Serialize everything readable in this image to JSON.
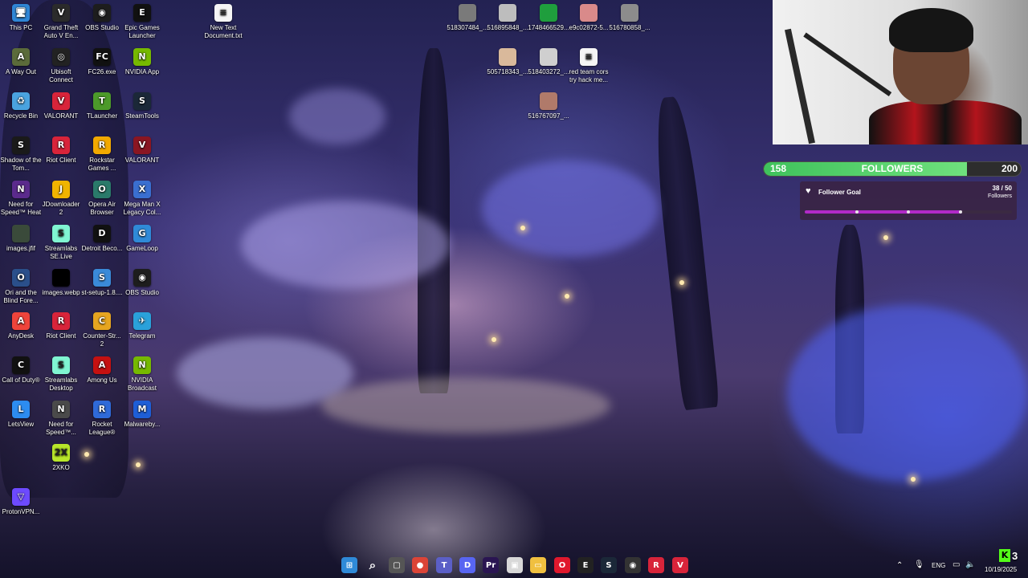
{
  "desktop_icons": [
    {
      "label": "This PC",
      "icon": "this-pc-icon",
      "color": "#2f86d6",
      "glyph": "🖥"
    },
    {
      "label": "Grand Theft Auto V En...",
      "icon": "gta-v-icon",
      "color": "#2b2b2b",
      "glyph": "V"
    },
    {
      "label": "OBS Studio",
      "icon": "obs-studio-icon",
      "color": "#1d1d1d",
      "glyph": "◉"
    },
    {
      "label": "Epic Games Launcher",
      "icon": "epic-games-icon",
      "color": "#111111",
      "glyph": "E"
    },
    {
      "label": "New Text Document.txt",
      "icon": "text-file-icon",
      "color": "#f5f5f5",
      "glyph": "≡"
    },
    {
      "label": "518307484_...",
      "icon": "image-file-icon",
      "color": "#7a7a7a",
      "glyph": ""
    },
    {
      "label": "516895848_...",
      "icon": "image-file-icon",
      "color": "#bdbdbd",
      "glyph": ""
    },
    {
      "label": "174846652​9...",
      "icon": "image-file-icon",
      "color": "#1f9e3d",
      "glyph": ""
    },
    {
      "label": "e9c02872-5...",
      "icon": "image-file-icon",
      "color": "#d98a8a",
      "glyph": ""
    },
    {
      "label": "516780858_...",
      "icon": "image-file-icon",
      "color": "#8c8c8c",
      "glyph": ""
    },
    {
      "label": "A Way Out",
      "icon": "a-way-out-icon",
      "color": "#5b6b3a",
      "glyph": "A"
    },
    {
      "label": "Ubisoft Connect",
      "icon": "ubisoft-icon",
      "color": "#222222",
      "glyph": "◎"
    },
    {
      "label": "FC26.exe",
      "icon": "fc26-icon",
      "color": "#111111",
      "glyph": "FC"
    },
    {
      "label": "NVIDIA App",
      "icon": "nvidia-app-icon",
      "color": "#76b900",
      "glyph": "N"
    },
    {
      "label": "505718343_...",
      "icon": "image-file-icon",
      "color": "#d9b99b",
      "glyph": ""
    },
    {
      "label": "518403272_...",
      "icon": "image-file-icon",
      "color": "#cfcfcf",
      "glyph": ""
    },
    {
      "label": "red team cors try hack me...",
      "icon": "text-file-icon",
      "color": "#f5f5f5",
      "glyph": "≡"
    },
    {
      "label": "Recycle Bin",
      "icon": "recycle-bin-icon",
      "color": "#4aa3df",
      "glyph": "♻"
    },
    {
      "label": "VALORANT",
      "icon": "valorant-icon",
      "color": "#d8243a",
      "glyph": "V"
    },
    {
      "label": "TLauncher",
      "icon": "tlauncher-icon",
      "color": "#4c9a2a",
      "glyph": "T"
    },
    {
      "label": "SteamTools",
      "icon": "steamtools-icon",
      "color": "#1b2838",
      "glyph": "S"
    },
    {
      "label": "516767097_...",
      "icon": "image-file-icon",
      "color": "#b07a6a",
      "glyph": ""
    },
    {
      "label": "Shadow of the Tom...",
      "icon": "shadow-tomb-raider-icon",
      "color": "#1a1a1a",
      "glyph": "S"
    },
    {
      "label": "Riot Client",
      "icon": "riot-client-icon",
      "color": "#d8243a",
      "glyph": "R"
    },
    {
      "label": "Rockstar Games ...",
      "icon": "rockstar-icon",
      "color": "#f2a900",
      "glyph": "R"
    },
    {
      "label": "VALORANT",
      "icon": "valorant-icon",
      "color": "#8a1622",
      "glyph": "V"
    },
    {
      "label": "Need for Speed™ Heat",
      "icon": "nfs-heat-icon",
      "color": "#5b2a8c",
      "glyph": "N"
    },
    {
      "label": "JDownloader 2",
      "icon": "jdownloader-icon",
      "color": "#f0b400",
      "glyph": "J"
    },
    {
      "label": "Opera Air Browser",
      "icon": "opera-air-icon",
      "color": "#2a7a6a",
      "glyph": "O"
    },
    {
      "label": "Mega Man X Legacy Col...",
      "icon": "mega-man-icon",
      "color": "#3a6fd0",
      "glyph": "X"
    },
    {
      "label": "images.jfif",
      "icon": "image-file-icon",
      "color": "#3a4a3a",
      "glyph": ""
    },
    {
      "label": "Streamlabs SE.Live",
      "icon": "streamlabs-se-icon",
      "color": "#80f5d2",
      "glyph": "S"
    },
    {
      "label": "Detroit Beco...",
      "icon": "detroit-icon",
      "color": "#111111",
      "glyph": "D"
    },
    {
      "label": "GameLoop",
      "icon": "gameloop-icon",
      "color": "#2f8ad8",
      "glyph": "G"
    },
    {
      "label": "Ori and the Blind Fore...",
      "icon": "ori-icon",
      "color": "#2a4f8a",
      "glyph": "O"
    },
    {
      "label": "images.webp",
      "icon": "image-file-icon",
      "color": "#000000",
      "glyph": ""
    },
    {
      "label": "st-setup-1.8....",
      "icon": "setup-icon",
      "color": "#3a8ad8",
      "glyph": "S"
    },
    {
      "label": "OBS Studio",
      "icon": "obs-studio-icon",
      "color": "#1d1d1d",
      "glyph": "◉"
    },
    {
      "label": "AnyDesk",
      "icon": "anydesk-icon",
      "color": "#ef443b",
      "glyph": "A"
    },
    {
      "label": "Riot Client",
      "icon": "riot-client-icon",
      "color": "#d8243a",
      "glyph": "R"
    },
    {
      "label": "Counter-Str... 2",
      "icon": "counter-strike-icon",
      "color": "#e6a520",
      "glyph": "C"
    },
    {
      "label": "Telegram",
      "icon": "telegram-icon",
      "color": "#2aa1da",
      "glyph": "✈"
    },
    {
      "label": "Call of Duty®",
      "icon": "call-of-duty-icon",
      "color": "#111111",
      "glyph": "C"
    },
    {
      "label": "Streamlabs Desktop",
      "icon": "streamlabs-icon",
      "color": "#80f5d2",
      "glyph": "S"
    },
    {
      "label": "Among Us",
      "icon": "among-us-icon",
      "color": "#c51111",
      "glyph": "A"
    },
    {
      "label": "NVIDIA Broadcast",
      "icon": "nvidia-broadcast-icon",
      "color": "#76b900",
      "glyph": "N"
    },
    {
      "label": "LetsView",
      "icon": "letsview-icon",
      "color": "#2d8cf0",
      "glyph": "L"
    },
    {
      "label": "Need for Speed™...",
      "icon": "need-for-speed-icon",
      "color": "#4a4a4a",
      "glyph": "N"
    },
    {
      "label": "Rocket League®",
      "icon": "rocket-league-icon",
      "color": "#2f6ad8",
      "glyph": "R"
    },
    {
      "label": "Malwareby...",
      "icon": "malwarebytes-icon",
      "color": "#1e5ed6",
      "glyph": "M"
    },
    {
      "label": "2XKO",
      "icon": "2xko-icon",
      "color": "#b8e62a",
      "glyph": "2X"
    },
    {
      "label": "ProtonVPN...",
      "icon": "protonvpn-icon",
      "color": "#6d4aff",
      "glyph": "▽"
    }
  ],
  "stream_overlay": {
    "followers": {
      "current": "158",
      "target": "200",
      "label": "FOLLOWERS",
      "progress": 0.79
    },
    "goal": {
      "title": "Follower Goal",
      "count": "38 / 50",
      "unit": "Followers",
      "progress": 0.76
    }
  },
  "taskbar": {
    "items": [
      {
        "name": "start-button",
        "icon": "windows-icon",
        "color": "#2f8ad8",
        "glyph": "⊞"
      },
      {
        "name": "taskbar-search",
        "icon": "search-icon",
        "color": "transparent",
        "glyph": "⌕"
      },
      {
        "name": "taskbar-task-view",
        "icon": "task-view-icon",
        "color": "#555",
        "glyph": "▢"
      },
      {
        "name": "taskbar-chrome",
        "icon": "chrome-icon",
        "color": "#db4437",
        "glyph": "●"
      },
      {
        "name": "taskbar-teams",
        "icon": "teams-icon",
        "color": "#5b5fc7",
        "glyph": "T"
      },
      {
        "name": "taskbar-discord",
        "icon": "discord-icon",
        "color": "#5865f2",
        "glyph": "D"
      },
      {
        "name": "taskbar-premiere",
        "icon": "premiere-icon",
        "color": "#2a1552",
        "glyph": "Pr"
      },
      {
        "name": "taskbar-photos",
        "icon": "photos-icon",
        "color": "#d8d8d8",
        "glyph": "▣"
      },
      {
        "name": "taskbar-file-explorer",
        "icon": "folder-icon",
        "color": "#f0c040",
        "glyph": "▭"
      },
      {
        "name": "taskbar-opera",
        "icon": "opera-icon",
        "color": "#e0182d",
        "glyph": "O"
      },
      {
        "name": "taskbar-epic",
        "icon": "epic-games-icon",
        "color": "#222",
        "glyph": "E"
      },
      {
        "name": "taskbar-steam",
        "icon": "steam-icon",
        "color": "#1b2838",
        "glyph": "S"
      },
      {
        "name": "taskbar-obs",
        "icon": "obs-studio-icon",
        "color": "#333",
        "glyph": "◉"
      },
      {
        "name": "taskbar-riot",
        "icon": "riot-client-icon",
        "color": "#d8243a",
        "glyph": "R"
      },
      {
        "name": "taskbar-valorant",
        "icon": "valorant-icon",
        "color": "#d8243a",
        "glyph": "V"
      }
    ],
    "language": "ENG",
    "date": "10/19/2025",
    "kick_badge": "3"
  }
}
